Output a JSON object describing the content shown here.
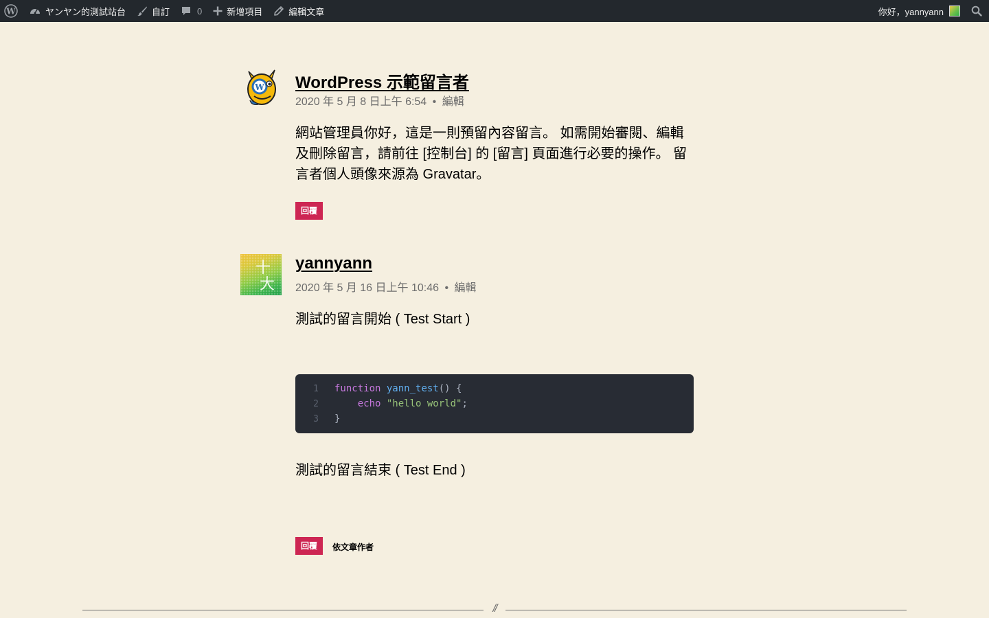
{
  "admin_bar": {
    "site_name": "ヤンヤン的測試站台",
    "customize": "自訂",
    "comments_count": "0",
    "new_item": "新增項目",
    "edit_post": "編輯文章",
    "greeting": "你好，yannyann"
  },
  "comments": [
    {
      "author": "WordPress 示範留言者",
      "date": "2020 年 5 月 8 日上午 6:54",
      "separator": "•",
      "edit": "編輯",
      "body": "網站管理員你好，這是一則預留內容留言。 如需開始審閱、編輯及刪除留言，請前往 [控制台] 的 [留言] 頁面進行必要的操作。 留言者個人頭像來源為 Gravatar。",
      "reply": "回覆"
    },
    {
      "author": "yannyann",
      "date": "2020 年 5 月 16 日上午 10:46",
      "separator": "•",
      "edit": "編輯",
      "body_start": "測試的留言開始 ( Test Start )",
      "code": {
        "line_numbers": [
          "1",
          "2",
          "3"
        ],
        "kw_function": "function",
        "fn_name": "yann_test",
        "parens_brace": "() {",
        "kw_echo": "    echo",
        "string": "\"hello world\"",
        "semicolon": ";",
        "close_brace": "}"
      },
      "body_end": "測試的留言結束 ( Test End )",
      "reply": "回覆",
      "by_author": "依文章作者"
    }
  ],
  "separator": {
    "mark": "//"
  }
}
